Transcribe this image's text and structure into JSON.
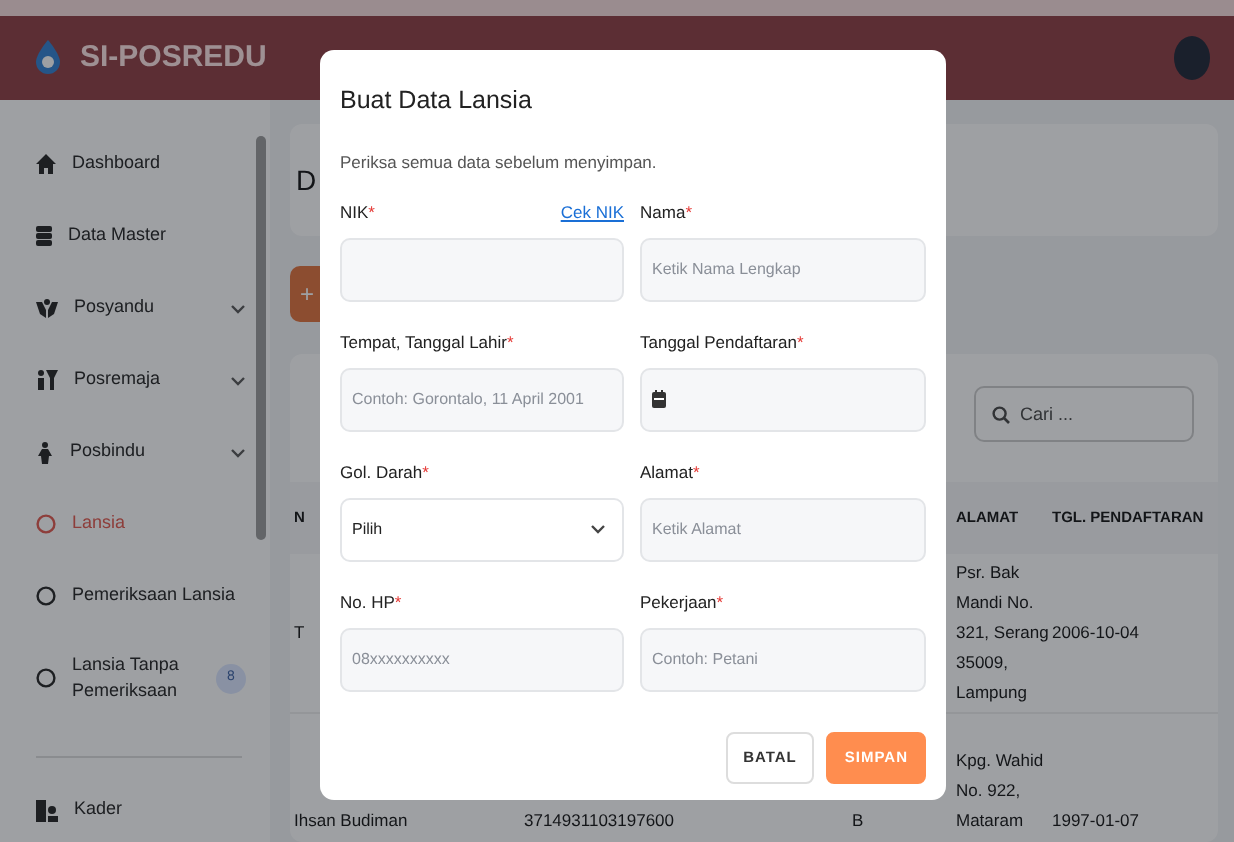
{
  "header": {
    "brand": "SI-POSREDU"
  },
  "sidebar": {
    "items": [
      {
        "label": "Dashboard",
        "kind": "home",
        "selected": false
      },
      {
        "label": "Data Master",
        "kind": "database",
        "selected": false
      },
      {
        "label": "Posyandu",
        "kind": "hands",
        "selected": false,
        "expandable": true
      },
      {
        "label": "Posremaja",
        "kind": "people",
        "selected": false,
        "expandable": true
      },
      {
        "label": "Posbindu",
        "kind": "person",
        "selected": false,
        "expandable": true
      },
      {
        "label": "Lansia",
        "kind": "circle",
        "selected": true
      },
      {
        "label": "Pemeriksaan Lansia",
        "kind": "circle",
        "selected": false
      },
      {
        "label": "Lansia Tanpa Pemeriksaan",
        "kind": "circle",
        "selected": false,
        "badge": "8"
      }
    ],
    "footer_items": [
      {
        "label": "Kader",
        "kind": "staff",
        "selected": false
      }
    ]
  },
  "page": {
    "title": "D",
    "add_button": "+",
    "search": {
      "placeholder": "Cari ..."
    },
    "table": {
      "columns": {
        "name": "N",
        "address": "ALAMAT",
        "registered": "TGL. PENDAFTARAN"
      },
      "rows": [
        {
          "name": "T",
          "address": "Psr. Bak Mandi No. 321, Serang 35009, Lampung",
          "registered": "2006-10-04"
        },
        {
          "name": "Ihsan Budiman",
          "nik": "3714931103197600",
          "blood_type": "B",
          "address": "Kpg. Wahid No. 922, Mataram",
          "registered": "1997-01-07"
        }
      ]
    }
  },
  "modal": {
    "title": "Buat Data Lansia",
    "subtitle": "Periksa semua data sebelum menyimpan.",
    "fields": [
      {
        "label": "NIK",
        "required_mark": "*",
        "kind": "text",
        "link": "Cek NIK"
      },
      {
        "label": "Nama",
        "required_mark": "*",
        "kind": "text",
        "placeholder": "Ketik Nama Lengkap"
      },
      {
        "label": "Tempat, Tanggal Lahir",
        "required_mark": "*",
        "kind": "text",
        "placeholder": "Contoh: Gorontalo, 11 April 2001"
      },
      {
        "label": "Tanggal Pendaftaran",
        "required_mark": "*",
        "kind": "date"
      },
      {
        "label": "Gol. Darah",
        "required_mark": "*",
        "kind": "select",
        "value": "Pilih"
      },
      {
        "label": "Alamat",
        "required_mark": "*",
        "kind": "text",
        "placeholder": "Ketik Alamat"
      },
      {
        "label": "No. HP",
        "required_mark": "*",
        "kind": "text",
        "placeholder": "08xxxxxxxxxx"
      },
      {
        "label": "Pekerjaan",
        "required_mark": "*",
        "kind": "text",
        "placeholder": "Contoh: Petani"
      }
    ],
    "buttons": [
      {
        "label": "BATAL",
        "kind": "cancel"
      },
      {
        "label": "SIMPAN",
        "kind": "primary"
      }
    ]
  }
}
